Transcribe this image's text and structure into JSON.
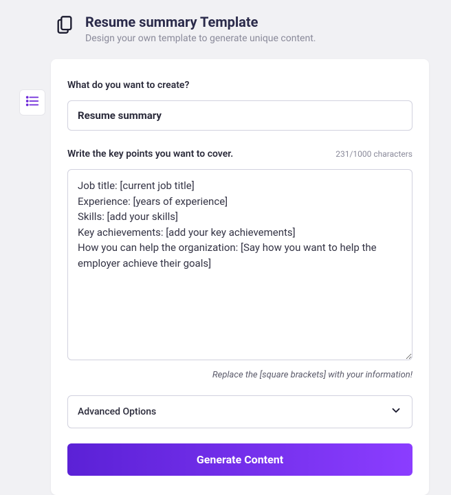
{
  "header": {
    "title": "Resume summary Template",
    "subtitle": "Design your own template to generate unique content."
  },
  "form": {
    "createLabel": "What do you want to create?",
    "createValue": "Resume summary",
    "keyPointsLabel": "Write the key points you want to cover.",
    "charCounter": "231/1000 characters",
    "keyPointsValue": "Job title: [current job title]\nExperience: [years of experience]\nSkills: [add your skills]\nKey achievements: [add your key achievements]\nHow you can help the organization: [Say how you want to help the employer achieve their goals]",
    "helperText": "Replace the [square brackets] with your information!",
    "advancedOptionsLabel": "Advanced Options",
    "generateButtonLabel": "Generate Content"
  }
}
